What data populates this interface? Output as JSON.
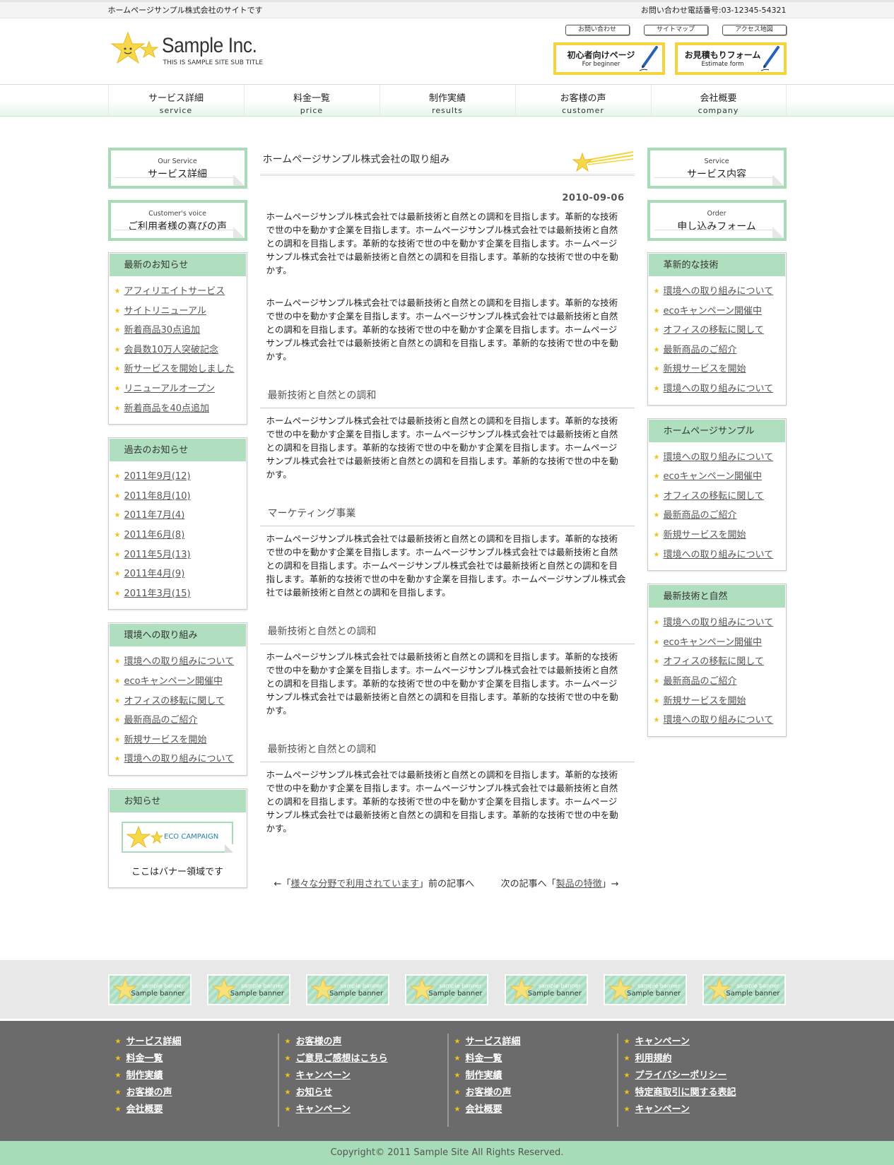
{
  "topbar": {
    "tagline": "ホームページサンプル株式会社のサイトです",
    "phone": "お問い合わせ電話番号:03-12345-54321"
  },
  "header": {
    "logo_name": "Sample Inc.",
    "logo_sub": "THIS IS SAMPLE SITE SUB TITLE",
    "links": [
      "お問い合わせ",
      "サイトマップ",
      "アクセス地図"
    ],
    "buttons": [
      {
        "label": "初心者向けページ",
        "sub": "For beginner"
      },
      {
        "label": "お見積もりフォーム",
        "sub": "Estimate form"
      }
    ]
  },
  "nav": [
    {
      "jp": "サービス詳細",
      "en": "service"
    },
    {
      "jp": "料金一覧",
      "en": "price"
    },
    {
      "jp": "制作実績",
      "en": "results"
    },
    {
      "jp": "お客様の声",
      "en": "customer"
    },
    {
      "jp": "会社概要",
      "en": "company"
    }
  ],
  "left": {
    "banners": [
      {
        "en": "Our Service",
        "jp": "サービス詳細"
      },
      {
        "en": "Customer's voice",
        "jp": "ご利用者様の喜びの声"
      }
    ],
    "boxes": [
      {
        "title": "最新のお知らせ",
        "items": [
          "アフィリエイトサービス",
          "サイトリニューアル",
          "新着商品30点追加",
          "会員数10万人突破記念",
          "新サービスを開始しました",
          "リニューアルオープン",
          "新着商品を40点追加"
        ]
      },
      {
        "title": "過去のお知らせ",
        "items": [
          "2011年9月(12)",
          "2011年8月(10)",
          "2011年7月(4)",
          "2011年6月(8)",
          "2011年5月(13)",
          "2011年4月(9)",
          "2011年3月(15)"
        ]
      },
      {
        "title": "環境への取り組み",
        "items": [
          "環境への取り組みについて",
          "ecoキャンペーン開催中",
          "オフィスの移転に関して",
          "最新商品のご紹介",
          "新規サービスを開始",
          "環境への取り組みについて"
        ]
      }
    ],
    "notice": {
      "title": "お知らせ",
      "eco_label": "ECO CAMPAIGN",
      "text": "ここはバナー領域です"
    }
  },
  "center": {
    "title": "ホームページサンプル株式会社の取り組み",
    "date": "2010-09-06",
    "paras": [
      "ホームページサンプル株式会社では最新技術と自然との調和を目指します。革新的な技術で世の中を動かす企業を目指します。ホームページサンプル株式会社では最新技術と自然との調和を目指します。革新的な技術で世の中を動かす企業を目指します。ホームページサンプル株式会社では最新技術と自然との調和を目指します。革新的な技術で世の中を動かす。",
      "ホームページサンプル株式会社では最新技術と自然との調和を目指します。革新的な技術で世の中を動かす企業を目指します。ホームページサンプル株式会社では最新技術と自然との調和を目指します。革新的な技術で世の中を動かす企業を目指します。ホームページサンプル株式会社では最新技術と自然との調和を目指します。革新的な技術で世の中を動かす。"
    ],
    "sections": [
      {
        "heading": "最新技術と自然との調和",
        "text": "ホームページサンプル株式会社では最新技術と自然との調和を目指します。革新的な技術で世の中を動かす企業を目指します。ホームページサンプル株式会社では最新技術と自然との調和を目指します。革新的な技術で世の中を動かす企業を目指します。ホームページサンプル株式会社では最新技術と自然との調和を目指します。革新的な技術で世の中を動かす。"
      },
      {
        "heading": "マーケティング事業",
        "text": "ホームページサンプル株式会社では最新技術と自然との調和を目指します。革新的な技術で世の中を動かす企業を目指します。ホームページサンプル株式会社では最新技術と自然との調和を目指します。ホームページサンプル株式会社では最新技術と自然との調和を目指します。革新的な技術で世の中を動かす企業を目指します。ホームページサンプル株式会社では最新技術と自然との調和を目指します。"
      },
      {
        "heading": "最新技術と自然との調和",
        "text": "ホームページサンプル株式会社では最新技術と自然との調和を目指します。革新的な技術で世の中を動かす企業を目指します。ホームページサンプル株式会社では最新技術と自然との調和を目指します。革新的な技術で世の中を動かす企業を目指します。ホームページサンプル株式会社では最新技術と自然との調和を目指します。革新的な技術で世の中を動かす。"
      },
      {
        "heading": "最新技術と自然との調和",
        "text": "ホームページサンプル株式会社では最新技術と自然との調和を目指します。革新的な技術で世の中を動かす企業を目指します。ホームページサンプル株式会社では最新技術と自然との調和を目指します。革新的な技術で世の中を動かす企業を目指します。ホームページサンプル株式会社では最新技術と自然との調和を目指します。革新的な技術で世の中を動かす。"
      }
    ],
    "pager": {
      "prev_pre": "←「",
      "prev_link": "様々な分野で利用されています",
      "prev_post": "」前の記事へ",
      "next_pre": "次の記事へ「",
      "next_link": "製品の特徴",
      "next_post": "」→"
    }
  },
  "right": {
    "banners": [
      {
        "en": "Service",
        "jp": "サービス内容"
      },
      {
        "en": "Order",
        "jp": "申し込みフォーム"
      }
    ],
    "boxes": [
      {
        "title": "革新的な技術",
        "items": [
          "環境への取り組みについて",
          "ecoキャンペーン開催中",
          "オフィスの移転に関して",
          "最新商品のご紹介",
          "新規サービスを開始",
          "環境への取り組みについて"
        ]
      },
      {
        "title": "ホームページサンプル",
        "items": [
          "環境への取り組みについて",
          "ecoキャンペーン開催中",
          "オフィスの移転に関して",
          "最新商品のご紹介",
          "新規サービスを開始",
          "環境への取り組みについて"
        ]
      },
      {
        "title": "最新技術と自然",
        "items": [
          "環境への取り組みについて",
          "ecoキャンペーン開催中",
          "オフィスの移転に関して",
          "最新商品のご紹介",
          "新規サービスを開始",
          "環境への取り組みについて"
        ]
      }
    ]
  },
  "banner_strip": [
    {
      "small": "sample banner",
      "label": "Sample banner"
    },
    {
      "small": "sample banner",
      "label": "Sample banner"
    },
    {
      "small": "sample banner",
      "label": "Sample banner"
    },
    {
      "small": "sample banner",
      "label": "Sample banner"
    },
    {
      "small": "sample banner",
      "label": "Sample banner"
    },
    {
      "small": "sample banner",
      "label": "Sample banner"
    },
    {
      "small": "sample banner",
      "label": "Sample banner"
    }
  ],
  "footer": {
    "columns": [
      [
        "サービス詳細",
        "料金一覧",
        "制作実績",
        "お客様の声",
        "会社概要"
      ],
      [
        "お客様の声",
        "ご意見ご感想はこちら",
        "キャンペーン",
        "お知らせ",
        "キャンペーン"
      ],
      [
        "サービス詳細",
        "料金一覧",
        "制作実績",
        "お客様の声",
        "会社概要"
      ],
      [
        "キャンペーン",
        "利用規約",
        "プライバシーポリシー",
        "特定商取引に関する表記",
        "キャンペーン"
      ]
    ],
    "copyright": "Copyright© 2011 Sample Site All Rights Reserved."
  },
  "colors": {
    "accent_green": "#afdfbe",
    "star_yellow": "#f0c419",
    "button_border": "#f4d43a",
    "footer_bg": "#6b6b6b"
  }
}
